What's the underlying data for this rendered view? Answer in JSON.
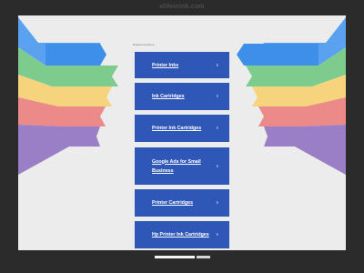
{
  "header": {
    "domain": "alifeinink.com"
  },
  "related": {
    "title": "Related searches"
  },
  "links": [
    {
      "label": "Printer Inks"
    },
    {
      "label": "Ink Cartridges"
    },
    {
      "label": "Printer Ink Cartridges"
    },
    {
      "label": "Google Ads for Small Business"
    },
    {
      "label": "Printer Cartridges"
    },
    {
      "label": "Hp Printer Ink Cartridges"
    }
  ],
  "chevron_icon": "chevron-right-icon",
  "footer": {
    "search_value": "",
    "search_button": "",
    "note": ""
  },
  "colors": {
    "frame": "#2b2b2b",
    "page": "#ececec",
    "card": "#2f57b8",
    "wing_blue": "#5aa2f0",
    "wing_green": "#7ecb8e",
    "wing_yellow": "#f6d47e",
    "wing_red": "#eb8a89",
    "wing_purple": "#9b7fc6"
  }
}
